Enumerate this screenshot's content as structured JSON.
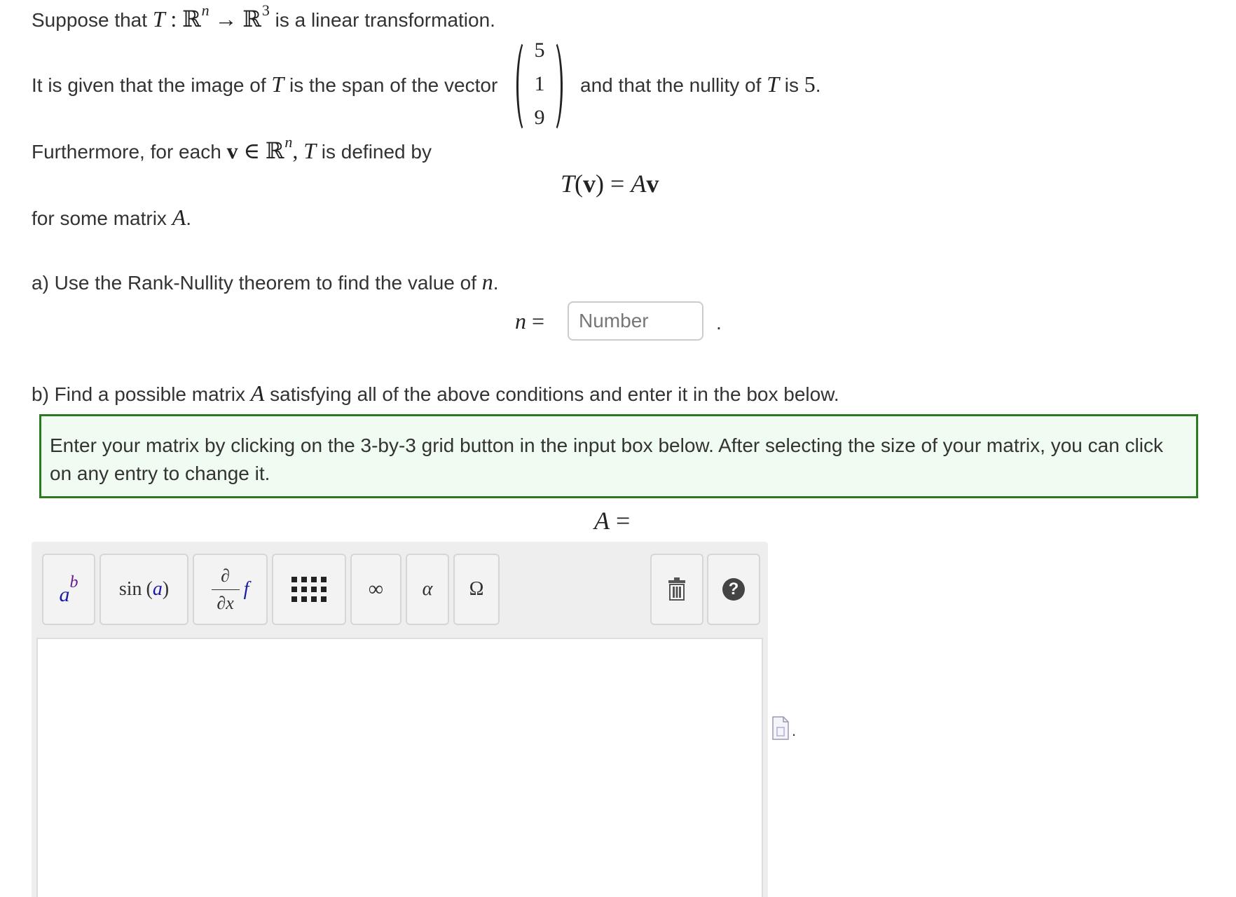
{
  "line1": {
    "prefix": "Suppose that",
    "math_T": "T",
    "math_colon": ":",
    "math_R": "ℝ",
    "math_n": "n",
    "math_arrow": "→",
    "math_R3": "ℝ",
    "math_3": "3",
    "suffix": "is a linear transformation."
  },
  "line2": {
    "prefix": "It is given that the image of",
    "math_T": "T",
    "middle": "is the span of the vector",
    "vector": [
      "5",
      "1",
      "9"
    ],
    "after_vector": "and that the nullity of",
    "math_T2": "T",
    "is_text": "is",
    "nullity": "5",
    "period": "."
  },
  "line3": {
    "prefix": "Furthermore, for each",
    "math_v": "v",
    "math_in": "∈",
    "math_R": "ℝ",
    "math_n": "n",
    "comma": ",",
    "math_T": "T",
    "suffix": "is defined by"
  },
  "display_eq": {
    "lhs_T": "T",
    "lhs_paren_open": "(",
    "lhs_v": "v",
    "lhs_paren_close": ")",
    "equals": "=",
    "rhs_A": "A",
    "rhs_v": "v"
  },
  "line4": {
    "prefix": "for some matrix",
    "math_A": "A",
    "period": "."
  },
  "part_a": {
    "text": "a) Use the Rank-Nullity theorem to find the value of",
    "math_n": "n",
    "period": ".",
    "lhs_n": "n",
    "equals": "=",
    "input_placeholder": "Number",
    "input_value": "",
    "trailing_dot": "."
  },
  "part_b": {
    "prefix": "b) Find a possible matrix",
    "math_A": "A",
    "suffix": "satisfying all of the above conditions and enter it in the box below.",
    "info": "Enter your matrix by clicking on the 3-by-3 grid button in the input box below. After selecting the size of your matrix, you can click on any entry to change it.",
    "lhs_A": "A",
    "equals": "="
  },
  "toolbar": {
    "superscript_base": "a",
    "superscript_exp": "b",
    "sin_label": "sin",
    "sin_arg": "a",
    "partial_num": "∂",
    "partial_den": "∂x",
    "partial_f": "f",
    "infinity": "∞",
    "alpha": "α",
    "omega": "Ω",
    "help": "?"
  },
  "file_dot": "."
}
